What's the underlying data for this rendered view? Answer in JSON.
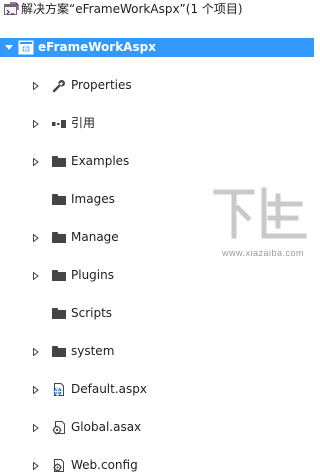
{
  "solution": {
    "title": "解决方案“eFrameWorkAspx”(1 个项目)"
  },
  "project": {
    "name": "eFrameWorkAspx"
  },
  "items": [
    {
      "label": "Properties",
      "icon": "wrench-icon",
      "expandable": true
    },
    {
      "label": "引用",
      "icon": "references-icon",
      "expandable": true
    },
    {
      "label": "Examples",
      "icon": "folder-icon",
      "expandable": true
    },
    {
      "label": "Images",
      "icon": "folder-icon",
      "expandable": false
    },
    {
      "label": "Manage",
      "icon": "folder-icon",
      "expandable": true
    },
    {
      "label": "Plugins",
      "icon": "folder-icon",
      "expandable": true
    },
    {
      "label": "Scripts",
      "icon": "folder-icon",
      "expandable": false
    },
    {
      "label": "system",
      "icon": "folder-icon",
      "expandable": true
    },
    {
      "label": "Default.aspx",
      "icon": "aspx-file-icon",
      "expandable": true
    },
    {
      "label": "Global.asax",
      "icon": "asax-file-icon",
      "expandable": true
    },
    {
      "label": "Web.config",
      "icon": "config-file-icon",
      "expandable": true
    }
  ],
  "watermark": {
    "site": "www.xiazaiba.com"
  },
  "colors": {
    "selection": "#3399ff",
    "icon_dark": "#454545",
    "arrow": "#8e8f8f",
    "web_blue": "#1e6fc9"
  }
}
